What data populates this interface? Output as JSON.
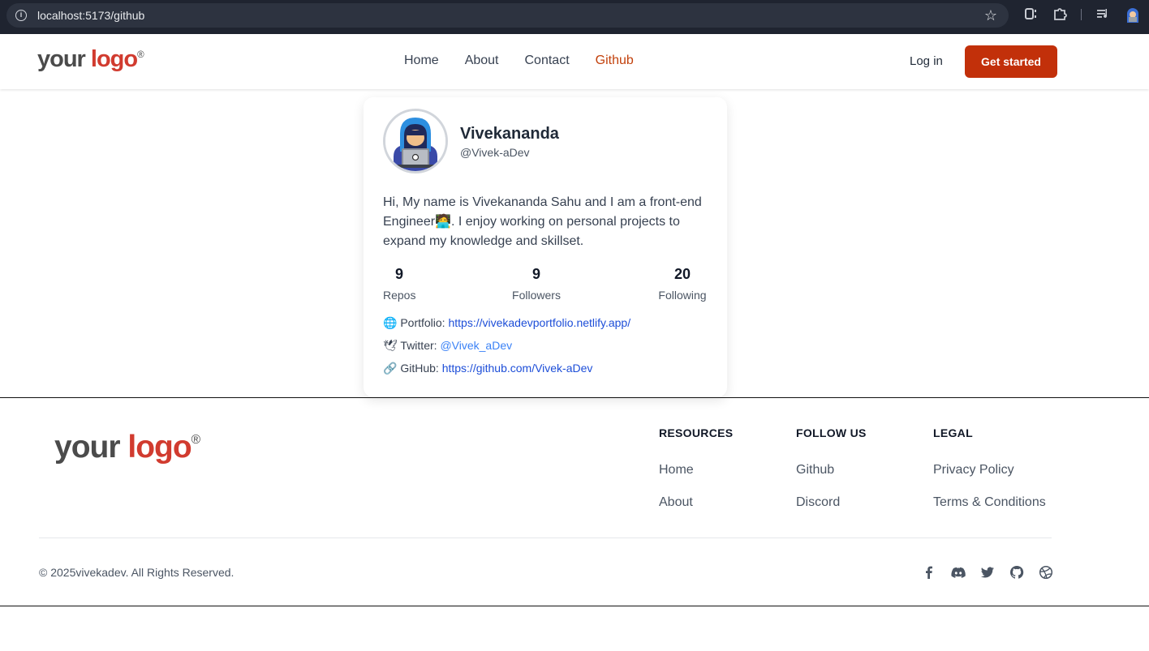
{
  "browser": {
    "url": "localhost:5173/github"
  },
  "nav": {
    "logo_your": "your",
    "logo_logo": "logo",
    "links": [
      "Home",
      "About",
      "Contact",
      "Github"
    ],
    "active": "Github",
    "login": "Log in",
    "cta": "Get started"
  },
  "profile": {
    "name": "Vivekananda",
    "handle": "@Vivek-aDev",
    "bio": "Hi, My name is Vivekananda Sahu and I am a front-end Engineer🧑‍💻. I enjoy working on personal projects to expand my knowledge and skillset.",
    "stats": [
      {
        "value": "9",
        "label": "Repos"
      },
      {
        "value": "9",
        "label": "Followers"
      },
      {
        "value": "20",
        "label": "Following"
      }
    ],
    "links": [
      {
        "icon": "🌐",
        "label": "Portfolio:",
        "value": "https://vivekadevportfolio.netlify.app/"
      },
      {
        "icon": "🕊",
        "label": "Twitter:",
        "value": "@Vivek_aDev"
      },
      {
        "icon": "🔗",
        "label": "GitHub:",
        "value": "https://github.com/Vivek-aDev"
      }
    ]
  },
  "footer": {
    "logo_your": "your",
    "logo_logo": "logo",
    "columns": [
      {
        "heading": "RESOURCES",
        "items": [
          "Home",
          "About"
        ]
      },
      {
        "heading": "FOLLOW US",
        "items": [
          "Github",
          "Discord"
        ]
      },
      {
        "heading": "LEGAL",
        "items": [
          "Privacy Policy",
          "Terms & Conditions"
        ]
      }
    ],
    "copyright": "© 2025vivekadev. All Rights Reserved.",
    "social_icons": [
      "facebook-icon",
      "discord-icon",
      "twitter-icon",
      "github-icon",
      "dribbble-icon"
    ]
  },
  "colors": {
    "accent": "#c2300a",
    "logo_red": "#d13b2f",
    "link_blue": "#1d4ed8"
  }
}
